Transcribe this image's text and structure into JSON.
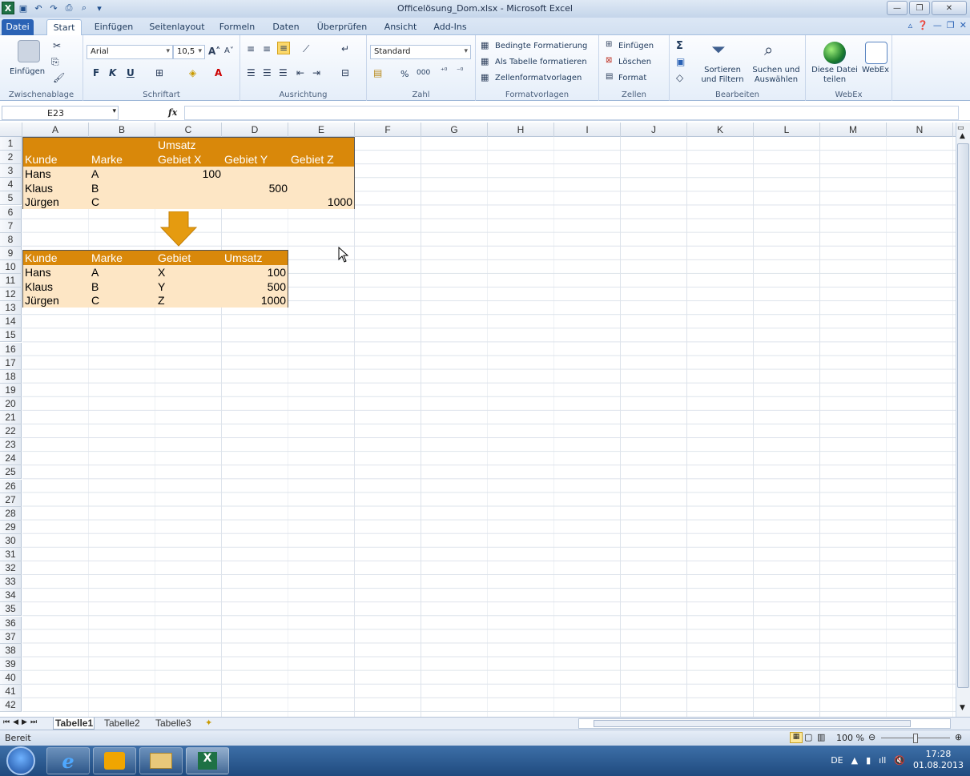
{
  "window": {
    "title": "Officelösung_Dom.xlsx - Microsoft Excel"
  },
  "tabs": {
    "file": "Datei",
    "items": [
      "Start",
      "Einfügen",
      "Seitenlayout",
      "Formeln",
      "Daten",
      "Überprüfen",
      "Ansicht",
      "Add-Ins"
    ]
  },
  "ribbon": {
    "clipboard": {
      "label": "Zwischenablage",
      "paste": "Einfügen"
    },
    "font": {
      "label": "Schriftart",
      "name": "Arial",
      "size": "10,5",
      "bold": "F",
      "italic": "K",
      "underline": "U"
    },
    "alignment": {
      "label": "Ausrichtung"
    },
    "number": {
      "label": "Zahl",
      "format": "Standard",
      "percent": "%",
      "thousands": "000"
    },
    "styles": {
      "label": "Formatvorlagen",
      "conditional": "Bedingte Formatierung",
      "as_table": "Als Tabelle formatieren",
      "cell_styles": "Zellenformatvorlagen"
    },
    "cells": {
      "label": "Zellen",
      "insert": "Einfügen",
      "delete": "Löschen",
      "format": "Format"
    },
    "editing": {
      "label": "Bearbeiten",
      "sum": "Σ",
      "sort": "Sortieren und Filtern",
      "find": "Suchen und Auswählen"
    },
    "webex": {
      "label": "WebEx",
      "share": "Diese Datei teilen",
      "webex": "WebEx"
    }
  },
  "formula_bar": {
    "name_box": "E23",
    "fx": "fx",
    "value": ""
  },
  "columns": [
    "A",
    "B",
    "C",
    "D",
    "E",
    "F",
    "G",
    "H",
    "I",
    "J",
    "K",
    "L",
    "M",
    "N"
  ],
  "rows": [
    "1",
    "2",
    "3",
    "4",
    "5",
    "6",
    "7",
    "8",
    "9",
    "10",
    "11",
    "12",
    "13",
    "14",
    "15",
    "16",
    "17",
    "18",
    "19",
    "20",
    "21",
    "22",
    "23",
    "24",
    "25",
    "26",
    "27",
    "28",
    "29",
    "30",
    "31",
    "32",
    "33",
    "34",
    "35",
    "36",
    "37",
    "38",
    "39",
    "40",
    "41",
    "42"
  ],
  "table1": {
    "c1": "Umsatz",
    "headers": [
      "Kunde",
      "Marke",
      "Gebiet X",
      "Gebiet Y",
      "Gebiet Z"
    ],
    "rows": [
      {
        "kunde": "Hans",
        "marke": "A",
        "x": "100",
        "y": "",
        "z": ""
      },
      {
        "kunde": "Klaus",
        "marke": "B",
        "x": "",
        "y": "500",
        "z": ""
      },
      {
        "kunde": "Jürgen",
        "marke": "C",
        "x": "",
        "y": "",
        "z": "1000"
      }
    ]
  },
  "table2": {
    "headers": [
      "Kunde",
      "Marke",
      "Gebiet",
      "Umsatz"
    ],
    "rows": [
      {
        "kunde": "Hans",
        "marke": "A",
        "gebiet": "X",
        "umsatz": "100"
      },
      {
        "kunde": "Klaus",
        "marke": "B",
        "gebiet": "Y",
        "umsatz": "500"
      },
      {
        "kunde": "Jürgen",
        "marke": "C",
        "gebiet": "Z",
        "umsatz": "1000"
      }
    ]
  },
  "sheets": [
    "Tabelle1",
    "Tabelle2",
    "Tabelle3"
  ],
  "status": {
    "ready": "Bereit",
    "zoom": "100 %"
  },
  "taskbar": {
    "lang": "DE",
    "time": "17:28",
    "date": "01.08.2013"
  },
  "colors": {
    "header": "#d9880a",
    "body": "#fde6c5"
  }
}
